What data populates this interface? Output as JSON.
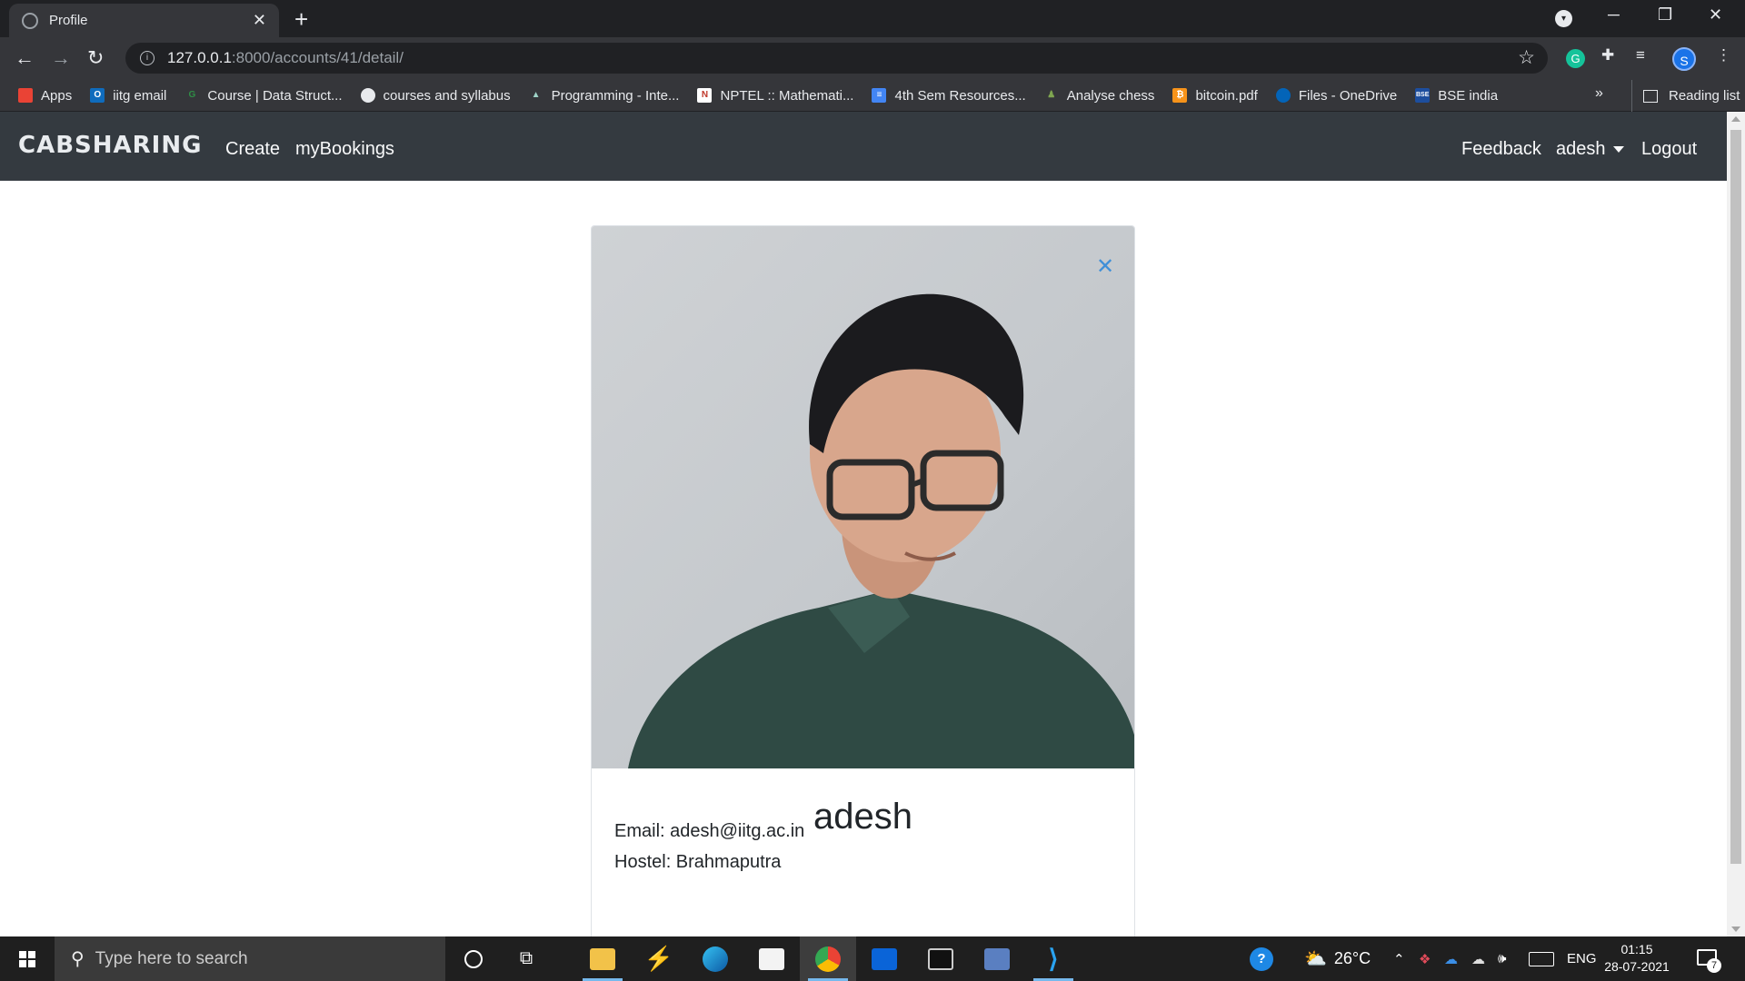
{
  "browser": {
    "tab_title": "Profile",
    "tab_close": "✕",
    "new_tab": "+",
    "url_host": "127.0.0.1",
    "url_path": ":8000/accounts/41/detail/",
    "profile_initial": "S",
    "extension_initial": "G"
  },
  "bookmarks": {
    "items": [
      {
        "label": "Apps",
        "color": "#ea4335"
      },
      {
        "label": "iitg email",
        "color": "#0f6cbd"
      },
      {
        "label": "Course | Data Struct...",
        "color": "#2f8d46"
      },
      {
        "label": "courses and syllabus",
        "color": "#e8eaed"
      },
      {
        "label": "Programming - Inte...",
        "color": "#5f9ea0"
      },
      {
        "label": "NPTEL :: Mathemati...",
        "color": "#c0392b"
      },
      {
        "label": "4th Sem Resources...",
        "color": "#4285f4"
      },
      {
        "label": "Analyse chess",
        "color": "#7fa650"
      },
      {
        "label": "bitcoin.pdf",
        "color": "#f7931a"
      },
      {
        "label": "Files - OneDrive",
        "color": "#0364b8"
      },
      {
        "label": "BSE india",
        "color": "#1d4e9e"
      }
    ],
    "more": "»",
    "reading_list": "Reading list"
  },
  "site": {
    "brand": "CABSHARING",
    "nav_create": "Create",
    "nav_bookings": "myBookings",
    "nav_feedback": "Feedback",
    "nav_user": "adesh",
    "nav_logout": "Logout"
  },
  "profile": {
    "close": "✕",
    "name": "adesh",
    "email_line": "Email: adesh@iitg.ac.in",
    "hostel_line": "Hostel: Brahmaputra"
  },
  "taskbar": {
    "search_placeholder": "Type here to search",
    "weather": "26°C",
    "language": "ENG",
    "time": "01:15",
    "date": "28-07-2021",
    "notification_count": "7"
  }
}
